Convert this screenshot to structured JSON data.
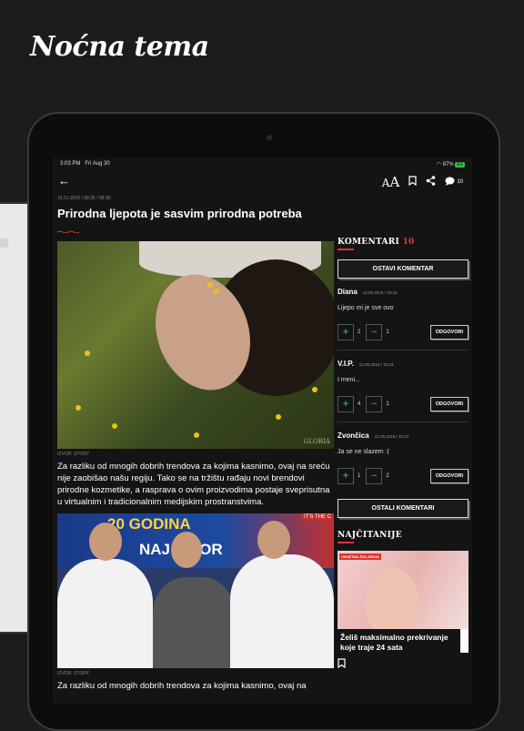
{
  "promo_title": "Noćna tema",
  "status": {
    "time": "3:03 PM",
    "date": "Fri Aug 30",
    "battery": "97%",
    "batt_badge": "EX"
  },
  "toolbar": {
    "comment_count": "10"
  },
  "article": {
    "dateline": "15.01.2019  /  08:35  /  08:30",
    "title": "Prirodna ljepota je sasvim prirodna potreba",
    "image1_watermark": "GLORIA",
    "image1_credit": "IZVOR: STORY",
    "paragraph1": "Za razliku od mnogih dobrih trendova za kojima kasnimo, ovaj na sreću nije zaobišao našu regiju. Tako se na tržištu rađaju novi brendovi prirodne kozmetike, a rasprava o ovim proizvodima postaje sveprisutna u virtualnim i tradicionalnim medijskim prostranstvima.",
    "image2_banner_line1": "20 GODINA",
    "image2_banner_line2": "NAJ   IZBOR",
    "image2_corner": "IT'S THE C",
    "image2_credit": "IZVOR: STORY",
    "paragraph2": "Za razliku od mnogih dobrih trendova za kojima kasnimo, ovaj na"
  },
  "comments": {
    "heading": "KOMENTARI",
    "count": "10",
    "add_label": "OSTAVI KOMENTAR",
    "more_label": "OSTALI KOMENTARI",
    "items": [
      {
        "name": "Diana",
        "date": "12.05.2018  /  10:23",
        "text": "Lijepo mi je sve ovo",
        "up": "2",
        "down": "1",
        "reply": "ODGOVORI"
      },
      {
        "name": "V.I.P.",
        "date": "12.05.2018  /  10:23",
        "text": "I meni...",
        "up": "4",
        "down": "1",
        "reply": "ODGOVORI"
      },
      {
        "name": "Zvončica",
        "date": "12.05.2018  /  10:23",
        "text": "Ja se ne slazem :(",
        "up": "1",
        "down": "2",
        "reply": "ODGOVORI"
      }
    ]
  },
  "most_read": {
    "heading": "NAJČITANIJE",
    "card": {
      "tag": "UMJETNA ŽIVLJENJA",
      "title": "Želiš maksimalno prekrivanje koje traje 24 sata"
    }
  },
  "colors": {
    "accent": "#dd3333",
    "background": "#141414",
    "upvote": "#2aa84a"
  }
}
